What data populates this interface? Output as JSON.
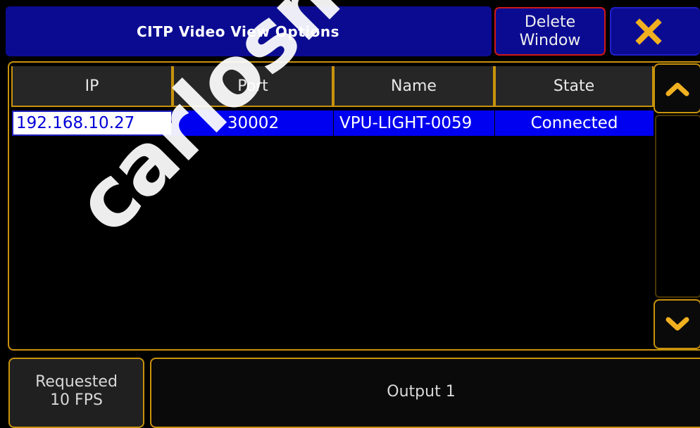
{
  "window": {
    "title": "CITP Video View Options",
    "delete_button": [
      "Delete",
      "Window"
    ],
    "close_icon": "close-x-icon"
  },
  "table": {
    "columns": [
      "IP",
      "Port",
      "Name",
      "State"
    ],
    "rows": [
      {
        "ip": "192.168.10.27",
        "port": "30002",
        "name": "VPU-LIGHT-0059",
        "state": "Connected"
      }
    ]
  },
  "scroll": {
    "up_icon": "chevron-up-icon",
    "down_icon": "chevron-down-icon"
  },
  "footer": {
    "requested_label": [
      "Requested",
      "10 FPS"
    ],
    "output_label": "Output 1"
  },
  "watermark": "carlosmendo",
  "colors": {
    "title_bg": "#0b0b92",
    "accent_border": "#c8920c",
    "selection": "#0000f0",
    "close_icon": "#f0b020",
    "delete_border": "#d01818"
  }
}
